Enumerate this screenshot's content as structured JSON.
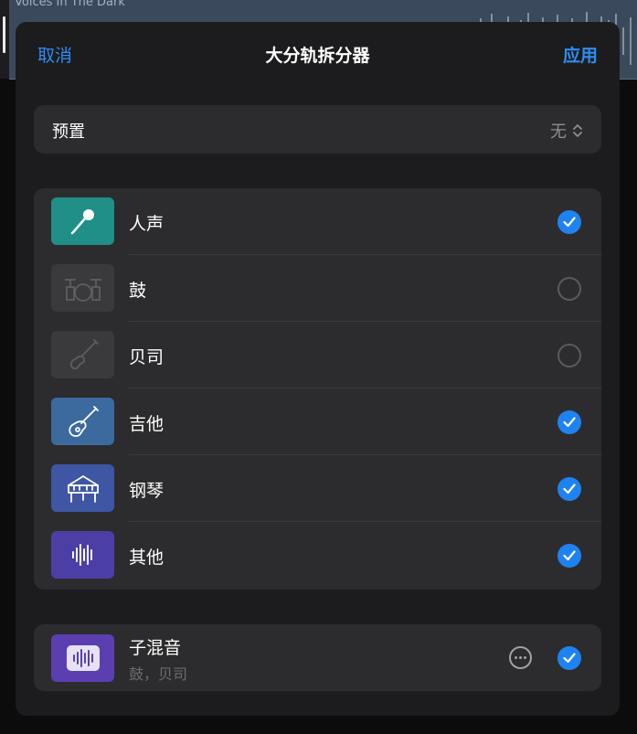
{
  "background_track": {
    "name": "Voices In The Dark"
  },
  "nav": {
    "cancel": "取消",
    "title": "大分轨拆分器",
    "apply": "应用"
  },
  "preset": {
    "label": "预置",
    "value": "无"
  },
  "stems": [
    {
      "label": "人声",
      "icon": "microphone-icon",
      "color": "#1f8f88",
      "checked": true
    },
    {
      "label": "鼓",
      "icon": "drums-icon",
      "color": "#3a3a3c",
      "checked": false
    },
    {
      "label": "贝司",
      "icon": "bass-guitar-icon",
      "color": "#3a3a3c",
      "checked": false
    },
    {
      "label": "吉他",
      "icon": "guitar-icon",
      "color": "#3d6a9e",
      "checked": true
    },
    {
      "label": "钢琴",
      "icon": "piano-icon",
      "color": "#3e56a3",
      "checked": true
    },
    {
      "label": "其他",
      "icon": "waveform-icon",
      "color": "#4b3fa6",
      "checked": true
    }
  ],
  "submix": {
    "label": "子混音",
    "detail": "鼓，贝司",
    "icon": "waveform-icon",
    "color": "#5b3fb0",
    "checked": true
  },
  "colors": {
    "accent": "#1e83f0"
  }
}
